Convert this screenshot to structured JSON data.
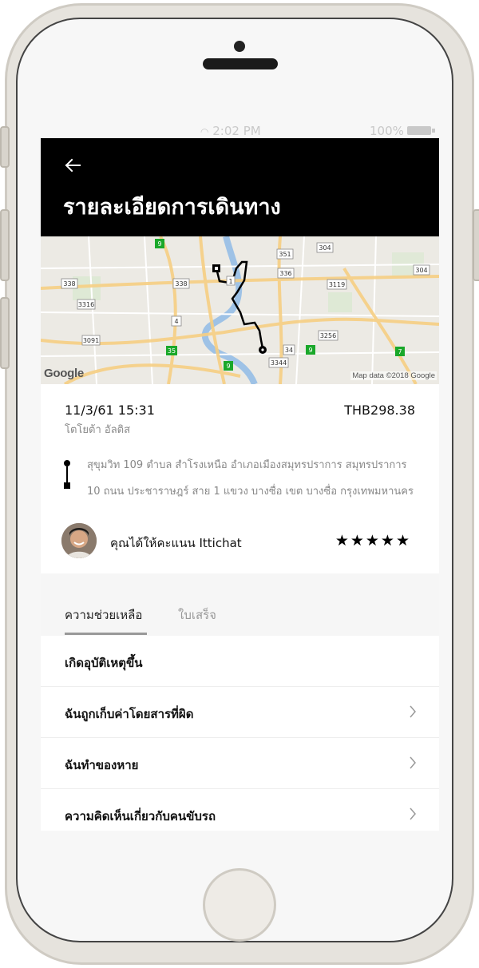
{
  "status_bar": {
    "time": "2:02 PM",
    "battery": "100%"
  },
  "header": {
    "title": "รายละเอียดการเดินทาง"
  },
  "map": {
    "logo": "Google",
    "credit": "Map data ©2018 Google",
    "road_shields": [
      "9",
      "351",
      "304",
      "338",
      "336",
      "3119",
      "304",
      "338",
      "3316",
      "4",
      "3091",
      "3256",
      "35",
      "34",
      "9",
      "7",
      "9",
      "3344",
      "1"
    ]
  },
  "trip": {
    "date": "11/3/61 15:31",
    "vehicle": "โตโยต้า อัลติส",
    "fare": "THB298.38",
    "pickup_address": "สุขุมวิท 109 ตำบล สำโรงเหนือ อำเภอเมืองสมุทรปราการ สมุทรปราการ",
    "dropoff_address": "10 ถนน ประชาราษฎร์ สาย 1 แขวง บางซื่อ เขต บางซื่อ กรุงเทพมหานคร"
  },
  "rating": {
    "text": "คุณได้ให้คะแนน Ittichat",
    "stars": "★★★★★"
  },
  "tabs": [
    {
      "label": "ความช่วยเหลือ"
    },
    {
      "label": "ใบเสร็จ"
    }
  ],
  "help_items": [
    {
      "label": "เกิดอุบัติเหตุขึ้น"
    },
    {
      "label": "ฉันถูกเก็บค่าโดยสารที่ผิด"
    },
    {
      "label": "ฉันทำของหาย"
    },
    {
      "label": "ความคิดเห็นเกี่ยวกับคนขับรถ"
    }
  ],
  "colors": {
    "header_bg": "#000000",
    "map_bg": "#eceae4",
    "road_major": "#f6cf83",
    "water": "#9ec2e6",
    "route": "#000000",
    "shield_green": "#1aa82a"
  }
}
